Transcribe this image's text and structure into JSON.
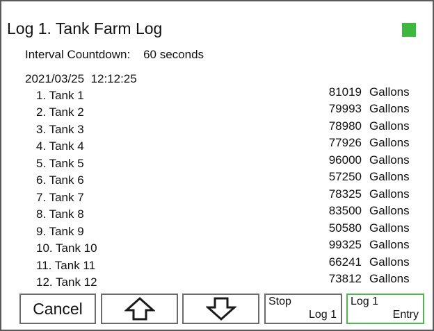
{
  "header": {
    "title": "Log 1.  Tank Farm Log",
    "status_color": "#3cb83c"
  },
  "interval": {
    "text": "Interval Countdown:    60 seconds"
  },
  "log": {
    "timestamp": "2021/03/25  12:12:25",
    "tanks": [
      {
        "name": "1. Tank 1",
        "value": "81019",
        "unit": "Gallons"
      },
      {
        "name": "2. Tank 2",
        "value": "79993",
        "unit": "Gallons"
      },
      {
        "name": "3. Tank 3",
        "value": "78980",
        "unit": "Gallons"
      },
      {
        "name": "4. Tank 4",
        "value": "77926",
        "unit": "Gallons"
      },
      {
        "name": "5. Tank 5",
        "value": "96000",
        "unit": "Gallons"
      },
      {
        "name": "6. Tank 6",
        "value": "57250",
        "unit": "Gallons"
      },
      {
        "name": "7. Tank 7",
        "value": "78325",
        "unit": "Gallons"
      },
      {
        "name": "8. Tank 8",
        "value": "83500",
        "unit": "Gallons"
      },
      {
        "name": "9. Tank 9",
        "value": "50580",
        "unit": "Gallons"
      },
      {
        "name": "10. Tank 10",
        "value": "99325",
        "unit": "Gallons"
      },
      {
        "name": "11. Tank 11",
        "value": "66241",
        "unit": "Gallons"
      },
      {
        "name": "12. Tank 12",
        "value": "73812",
        "unit": "Gallons"
      }
    ]
  },
  "buttons": {
    "cancel": "Cancel",
    "up_icon": "arrow-up-outline-icon",
    "down_icon": "arrow-down-outline-icon",
    "stop_top": "Stop",
    "stop_bottom": "Log 1",
    "entry_top": "Log 1",
    "entry_bottom": "Entry",
    "entry_border_color": "#4cb84c"
  }
}
